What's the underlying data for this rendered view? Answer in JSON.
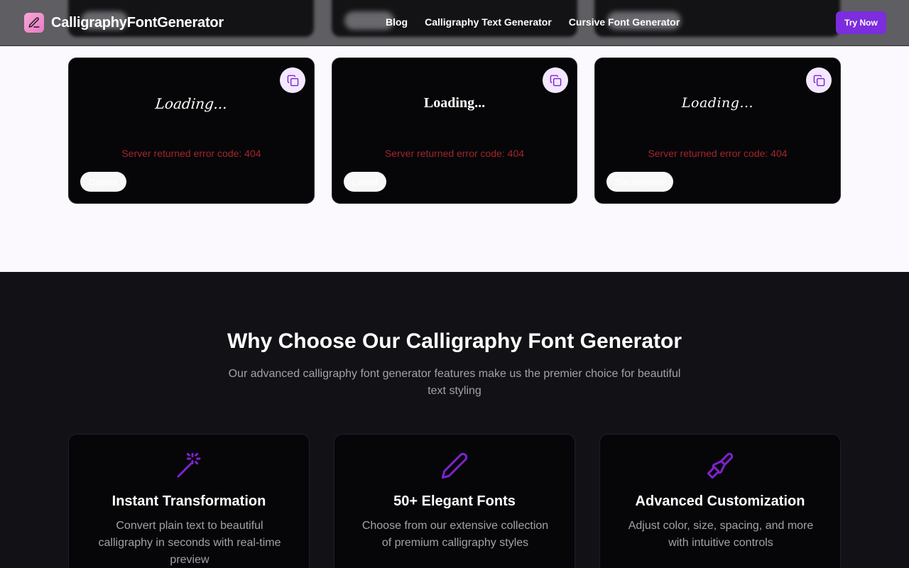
{
  "header": {
    "brand": "CalligraphyFontGenerator",
    "nav": [
      "Blog",
      "Calligraphy Text Generator",
      "Cursive Font Generator"
    ],
    "cta": "Try Now"
  },
  "preview": {
    "cards": [
      {
        "loading": "Loading...",
        "error": "Server returned error code: 404",
        "font": "Caveat"
      },
      {
        "loading": "Loading...",
        "error": "Server returned error code: 404",
        "font": "Lateef"
      },
      {
        "loading": "Loading...",
        "error": "Server returned error code: 404",
        "font": "Sacramento"
      }
    ]
  },
  "features": {
    "title": "Why Choose Our Calligraphy Font Generator",
    "subtitle": "Our advanced calligraphy font generator features make us the premier choice for beautiful text styling",
    "cards": [
      {
        "icon": "magic-wand-icon",
        "title": "Instant Transformation",
        "desc": "Convert plain text to beautiful calligraphy in seconds with real-time preview"
      },
      {
        "icon": "pen-icon",
        "title": "50+ Elegant Fonts",
        "desc": "Choose from our extensive collection of premium calligraphy styles"
      },
      {
        "icon": "paintbrush-icon",
        "title": "Advanced Customization",
        "desc": "Adjust color, size, spacing, and more with intuitive controls"
      }
    ]
  },
  "colors": {
    "accent": "#7c2dde",
    "icon": "#7e22ce",
    "error": "#a3262a",
    "dark": "#121216"
  }
}
